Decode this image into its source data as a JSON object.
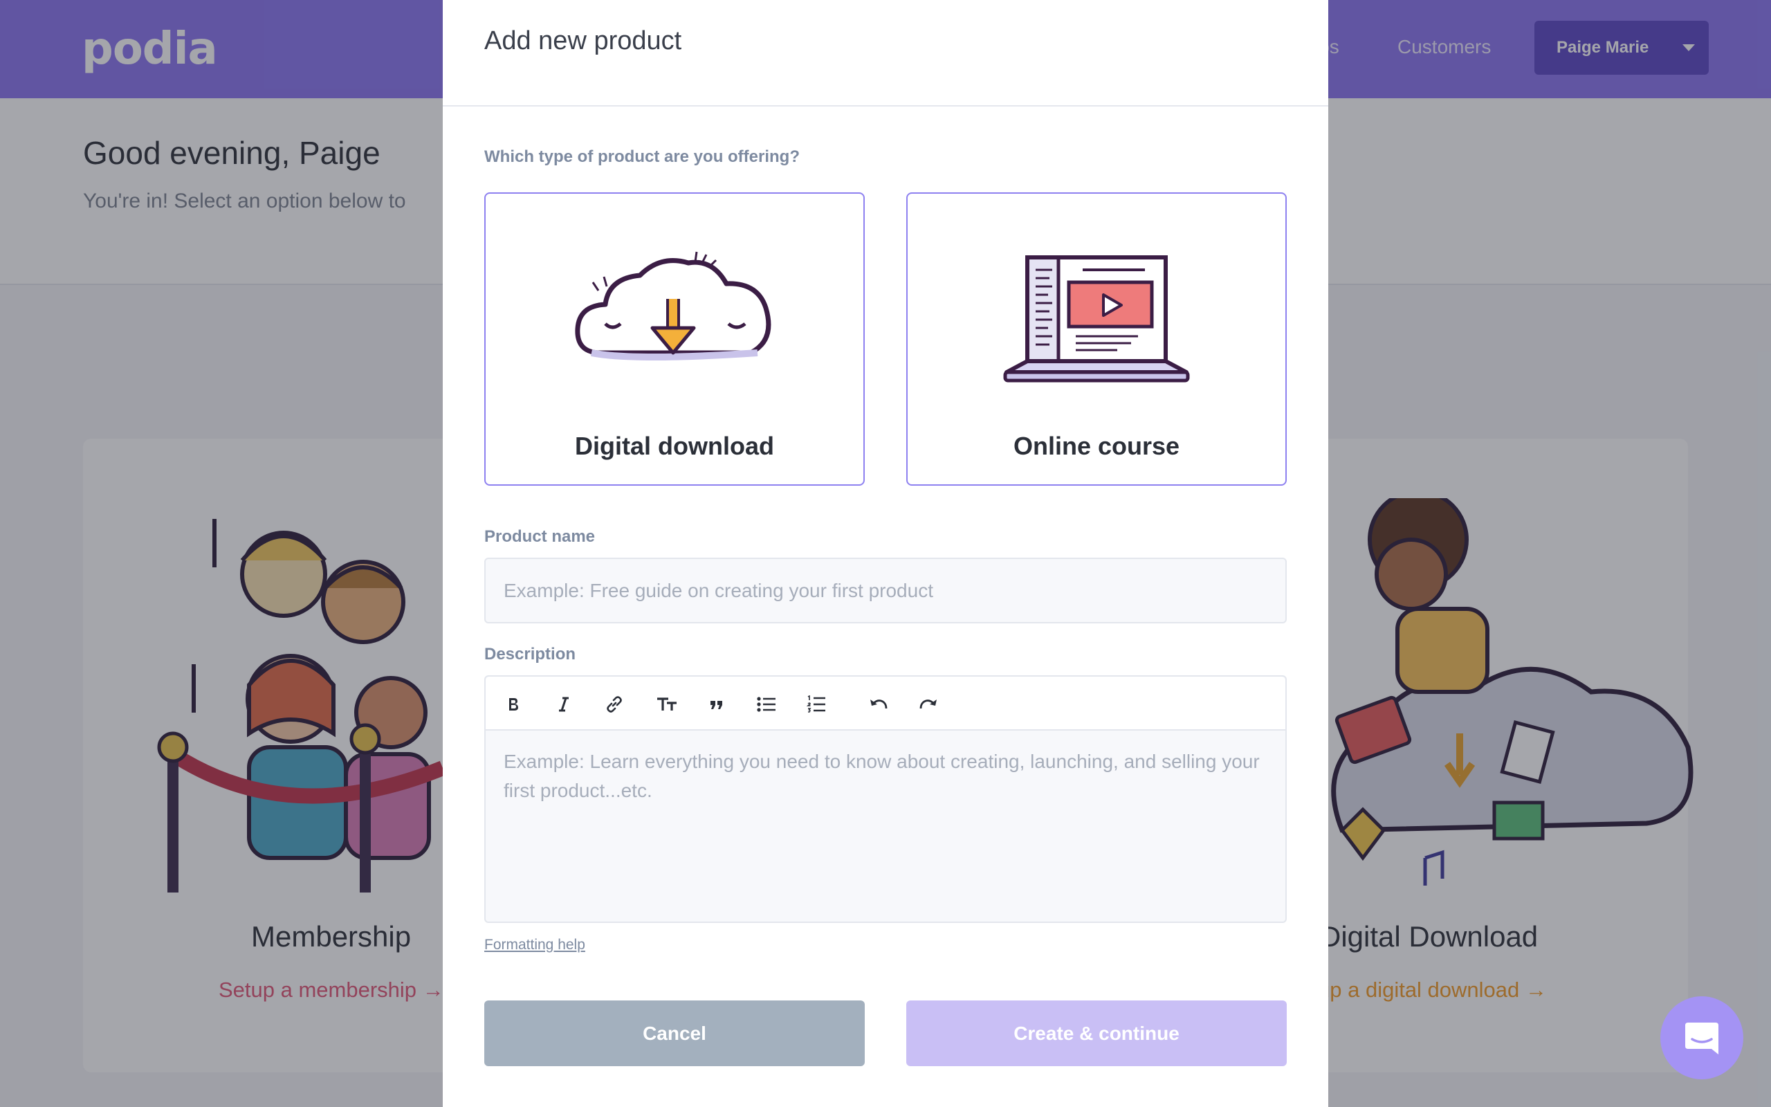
{
  "colors": {
    "brand": "#8a74f0",
    "card_border": "#8d80f0",
    "cancel": "#a3b0be",
    "create": "#c9bff5"
  },
  "header": {
    "logo": "podia",
    "nav": [
      "ips",
      "Customers"
    ],
    "user_name": "Paige Marie"
  },
  "greeting": {
    "title": "Good evening, Paige",
    "subtitle": "You're in! Select an option below to"
  },
  "background_cards": [
    {
      "title": "Membership",
      "link": "Setup a membership →"
    },
    {
      "title": "Digital Download",
      "link": "up a digital download →"
    }
  ],
  "modal": {
    "title": "Add new product",
    "question": "Which type of product are you offering?",
    "product_types": [
      {
        "label": "Digital download",
        "icon": "cloud-download-icon"
      },
      {
        "label": "Online course",
        "icon": "laptop-video-icon"
      }
    ],
    "product_name_label": "Product name",
    "product_name_placeholder": "Example: Free guide on creating your first product",
    "description_label": "Description",
    "toolbar": [
      "bold-icon",
      "italic-icon",
      "link-icon",
      "heading-icon",
      "quote-icon",
      "bullet-list-icon",
      "numbered-list-icon",
      "undo-icon",
      "redo-icon"
    ],
    "description_placeholder": "Example: Learn everything you need to know about creating, launching, and selling your first product...etc.",
    "formatting_help": "Formatting help",
    "cancel_label": "Cancel",
    "create_label": "Create & continue"
  }
}
